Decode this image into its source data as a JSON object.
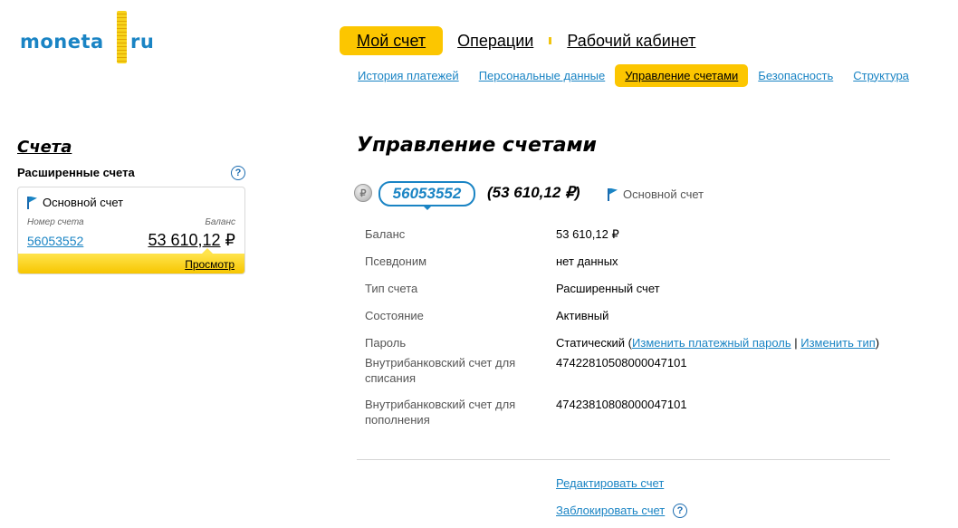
{
  "logo": {
    "left": "moneta",
    "right": "ru"
  },
  "topnav": [
    {
      "label": "Мой счет",
      "active": true
    },
    {
      "label": "Операции",
      "active": false
    },
    {
      "label": "Рабочий кабинет",
      "active": false
    }
  ],
  "subnav": [
    {
      "label": "История платежей",
      "active": false
    },
    {
      "label": "Персональные данные",
      "active": false
    },
    {
      "label": "Управление счетами",
      "active": true
    },
    {
      "label": "Безопасность",
      "active": false
    },
    {
      "label": "Структура",
      "active": false
    }
  ],
  "sidebar": {
    "title": "Счета",
    "subtitle": "Расширенные счета",
    "help": "?",
    "card": {
      "name": "Основной счет",
      "number_label": "Номер счета",
      "balance_label": "Баланс",
      "number": "56053552",
      "balance": "53 610,12",
      "currency": "₽",
      "view_link": "Просмотр"
    }
  },
  "main": {
    "title": "Управление счетами",
    "coin_icon": "₽",
    "account_number": "56053552",
    "account_balance": "(53 610,12 ₽)",
    "account_name": "Основной счет",
    "details": [
      {
        "label": "Баланс",
        "value": "53 610,12 ₽"
      },
      {
        "label": "Псевдоним",
        "value": "нет данных"
      },
      {
        "label": "Тип счета",
        "value": "Расширенный счет"
      },
      {
        "label": "Состояние",
        "value": "Активный"
      },
      {
        "label": "Пароль",
        "value_prefix": "Статический (",
        "link1": "Изменить платежный пароль",
        "sep": " | ",
        "link2": "Изменить тип",
        "value_suffix": ")"
      },
      {
        "label": "Внутрибанковский счет для списания",
        "value": "47422810508000047101"
      },
      {
        "label": "Внутрибанковский счет для пополнения",
        "value": "47423810808000047101"
      }
    ],
    "actions": {
      "edit": "Редактировать счет",
      "block": "Заблокировать счет",
      "help": "?"
    }
  },
  "colors": {
    "accent": "#fcc600",
    "link": "#1a84c4"
  }
}
